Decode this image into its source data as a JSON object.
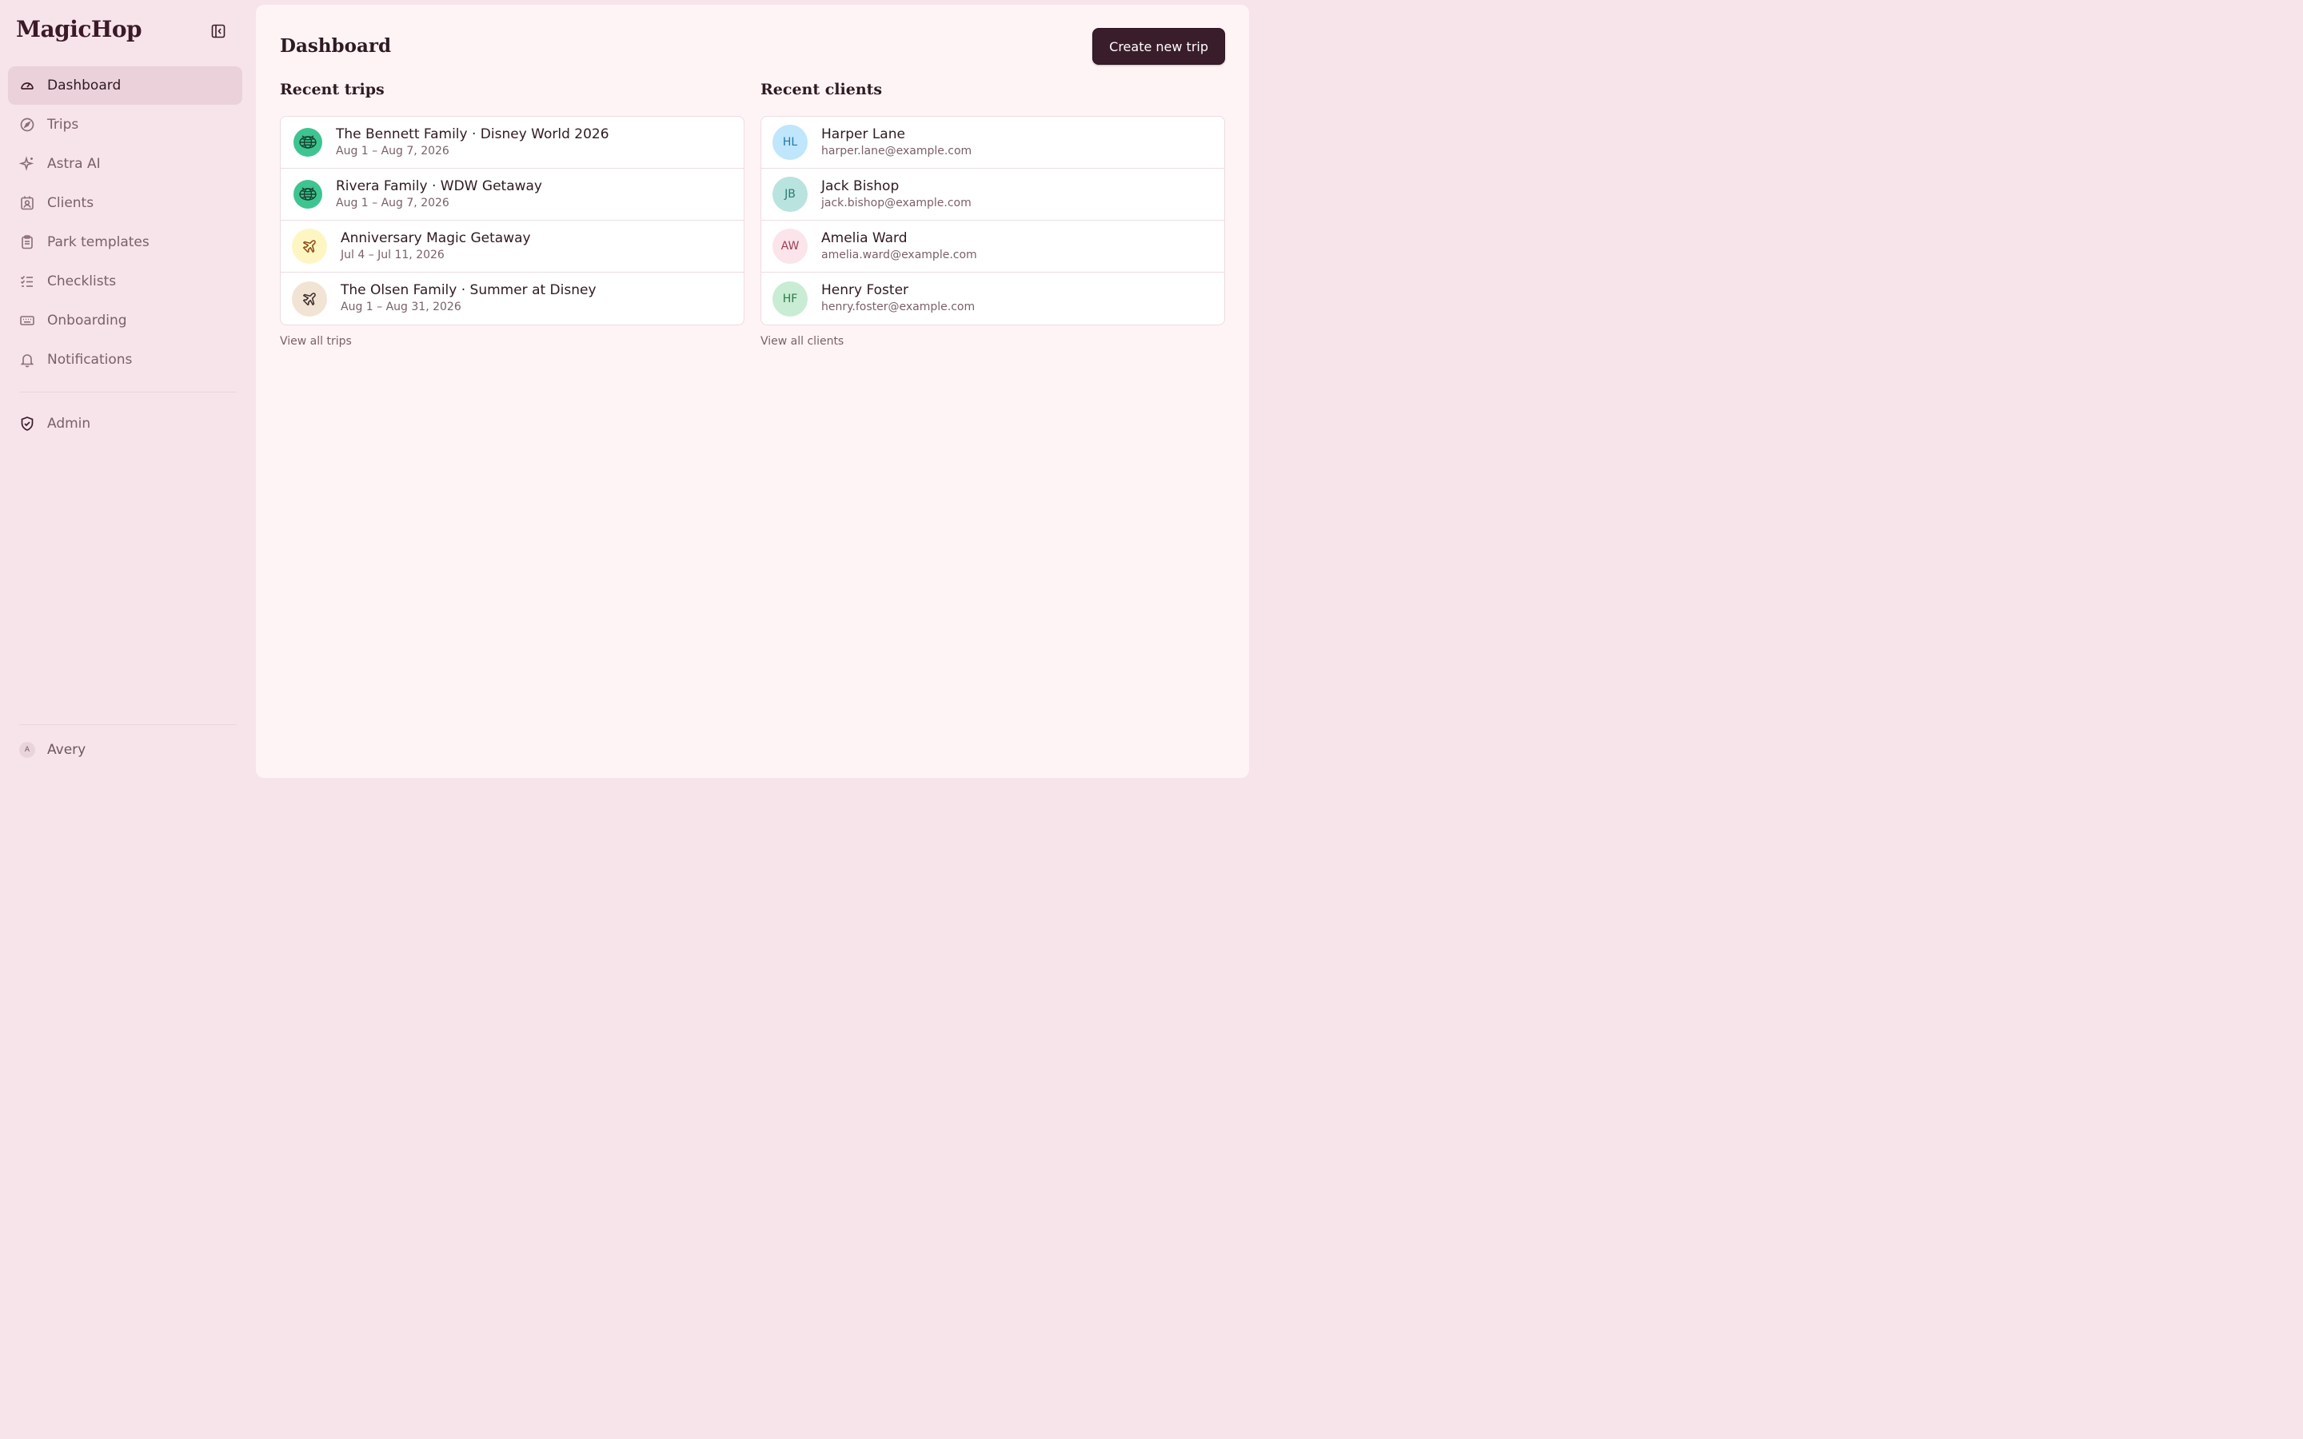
{
  "app": {
    "brand": "MagicHop"
  },
  "sidebar": {
    "items": [
      {
        "label": "Dashboard",
        "icon": "gauge-icon",
        "active": true
      },
      {
        "label": "Trips",
        "icon": "compass-icon"
      },
      {
        "label": "Astra AI",
        "icon": "sparkles-icon"
      },
      {
        "label": "Clients",
        "icon": "contact-icon"
      },
      {
        "label": "Park templates",
        "icon": "clipboard-icon"
      },
      {
        "label": "Checklists",
        "icon": "checklist-icon"
      },
      {
        "label": "Onboarding",
        "icon": "keyboard-icon"
      },
      {
        "label": "Notifications",
        "icon": "bell-icon"
      }
    ],
    "admin": {
      "label": "Admin",
      "icon": "shield-check-icon"
    },
    "user": {
      "initial": "A",
      "name": "Avery"
    }
  },
  "header": {
    "title": "Dashboard",
    "create_label": "Create new trip"
  },
  "trips": {
    "title": "Recent trips",
    "view_all": "View all trips",
    "items": [
      {
        "name": "The Bennett Family · Disney World 2026",
        "dates": "Aug 1 – Aug 7, 2026",
        "icon": "globe-icon",
        "color": "#3ec491"
      },
      {
        "name": "Rivera Family · WDW Getaway",
        "dates": "Aug 1 – Aug 7, 2026",
        "icon": "globe-icon",
        "color": "#3ec491"
      },
      {
        "name": "Anniversary Magic Getaway",
        "dates": "Jul 4 – Jul 11, 2026",
        "icon": "plane-icon",
        "color": "#fdf6c3"
      },
      {
        "name": "The Olsen Family · Summer at Disney",
        "dates": "Aug 1 – Aug 31, 2026",
        "icon": "plane-icon",
        "color": "#f1e4d5"
      }
    ]
  },
  "clients": {
    "title": "Recent clients",
    "view_all": "View all clients",
    "items": [
      {
        "initials": "HL",
        "name": "Harper Lane",
        "email": "harper.lane@example.com",
        "color": "#bfe6fb",
        "text_color": "#2476a8"
      },
      {
        "initials": "JB",
        "name": "Jack Bishop",
        "email": "jack.bishop@example.com",
        "color": "#b9e3de",
        "text_color": "#2b7a70"
      },
      {
        "initials": "AW",
        "name": "Amelia Ward",
        "email": "amelia.ward@example.com",
        "color": "#fbe4ea",
        "text_color": "#9b3f55"
      },
      {
        "initials": "HF",
        "name": "Henry Foster",
        "email": "henry.foster@example.com",
        "color": "#c9ecd4",
        "text_color": "#2e7a47"
      }
    ]
  }
}
